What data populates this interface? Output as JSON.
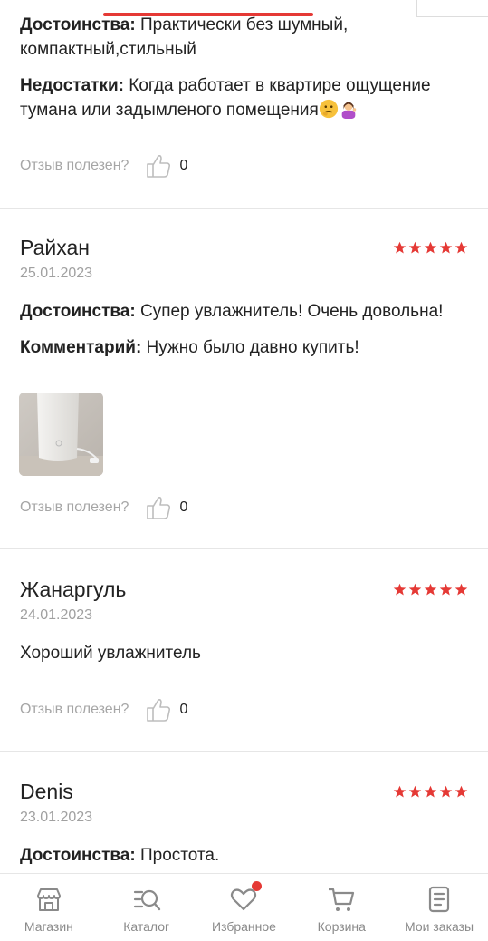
{
  "reviews": [
    {
      "pros_label": "Достоинства:",
      "pros_text": " Практически без шумный, компактный,стильный",
      "cons_label": "Недостатки:",
      "cons_text": " Когда работает в квартире ощущение тумана или задымленого помещения",
      "helpful_label": "Отзыв полезен?",
      "helpful_count": "0"
    },
    {
      "name": "Райхан",
      "date": "25.01.2023",
      "rating": 5,
      "pros_label": "Достоинства:",
      "pros_text": " Супер увлажнитель! Очень довольна!",
      "comment_label": "Комментарий:",
      "comment_text": " Нужно было давно купить!",
      "helpful_label": "Отзыв полезен?",
      "helpful_count": "0"
    },
    {
      "name": "Жанаргуль",
      "date": "24.01.2023",
      "rating": 5,
      "text": "Хороший увлажнитель",
      "helpful_label": "Отзыв полезен?",
      "helpful_count": "0"
    },
    {
      "name": "Denis",
      "date": "23.01.2023",
      "rating": 5,
      "pros_label": "Достоинства:",
      "pros_text": " Простота."
    }
  ],
  "nav": {
    "items": [
      {
        "label": "Магазин",
        "icon": "store-icon"
      },
      {
        "label": "Каталог",
        "icon": "catalog-search-icon"
      },
      {
        "label": "Избранное",
        "icon": "heart-icon"
      },
      {
        "label": "Корзина",
        "icon": "cart-icon"
      },
      {
        "label": "Мои заказы",
        "icon": "orders-icon"
      }
    ]
  },
  "colors": {
    "accent": "#e53935",
    "muted": "#a6a6a6"
  }
}
